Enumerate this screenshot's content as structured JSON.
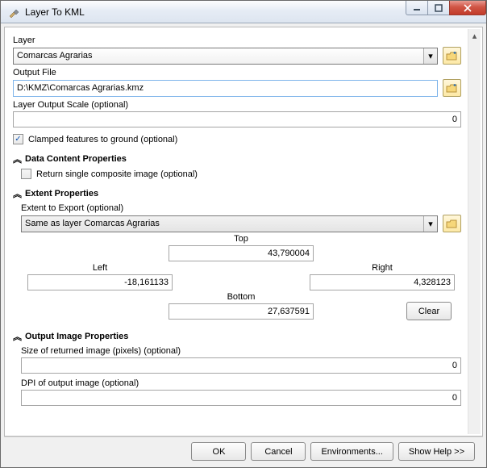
{
  "window": {
    "title": "Layer To KML"
  },
  "layer": {
    "label": "Layer",
    "value": "Comarcas Agrarias"
  },
  "output_file": {
    "label": "Output File",
    "value": "D:\\KMZ\\Comarcas Agrarias.kmz"
  },
  "layer_output_scale": {
    "label": "Layer Output Scale (optional)",
    "value": "0"
  },
  "clamped": {
    "label": "Clamped features to ground (optional)",
    "checked": true
  },
  "sections": {
    "data_content": "Data Content Properties",
    "extent": "Extent Properties",
    "output_image": "Output Image Properties"
  },
  "return_composite": {
    "label": "Return single composite image (optional)",
    "checked": false
  },
  "extent_to_export": {
    "label": "Extent to Export (optional)",
    "value": "Same as layer Comarcas Agrarias"
  },
  "extent": {
    "top_label": "Top",
    "top": "43,790004",
    "left_label": "Left",
    "left": "-18,161133",
    "right_label": "Right",
    "right": "4,328123",
    "bottom_label": "Bottom",
    "bottom": "27,637591",
    "clear": "Clear"
  },
  "size_returned": {
    "label": "Size of returned image (pixels) (optional)",
    "value": "0"
  },
  "dpi": {
    "label": "DPI of output image (optional)",
    "value": "0"
  },
  "footer": {
    "ok": "OK",
    "cancel": "Cancel",
    "environments": "Environments...",
    "show_help": "Show Help >>"
  }
}
